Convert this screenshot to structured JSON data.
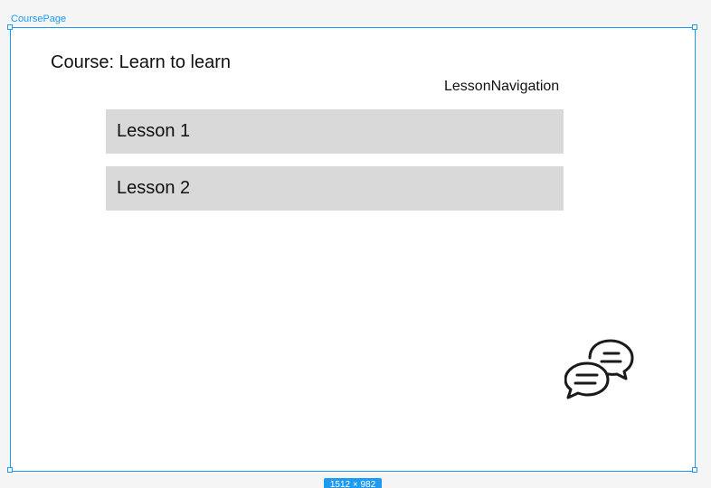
{
  "frame": {
    "name": "CoursePage",
    "size_badge": "1512 × 982"
  },
  "course": {
    "title": "Course: Learn to learn"
  },
  "lesson_navigation": {
    "label": "LessonNavigation",
    "lessons": [
      {
        "label": "Lesson 1"
      },
      {
        "label": "Lesson 2"
      }
    ]
  },
  "icons": {
    "chat": "chat-bubbles-icon"
  },
  "colors": {
    "selection": "#1e9bf0",
    "lesson_bg": "#d9d9d9",
    "canvas_bg": "#f5f5f5"
  }
}
